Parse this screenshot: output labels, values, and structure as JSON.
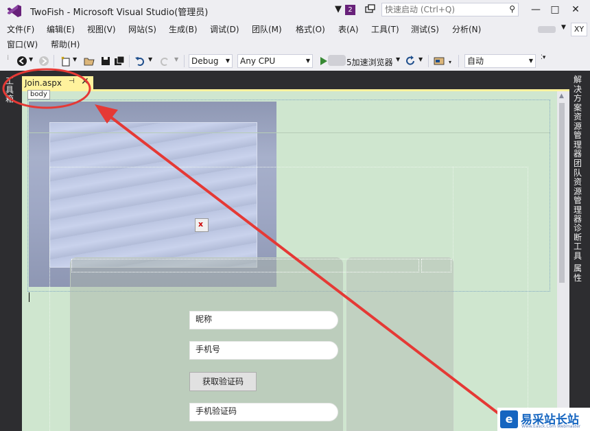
{
  "titlebar": {
    "title": "TwoFish - Microsoft Visual Studio(管理员)",
    "notifications": "2",
    "quick_launch_placeholder": "快速启动 (Ctrl+Q)",
    "min": "—",
    "max": "□",
    "close": "✕"
  },
  "menu": {
    "items": [
      "文件(F)",
      "编辑(E)",
      "视图(V)",
      "网站(S)",
      "生成(B)",
      "调试(D)",
      "团队(M)",
      "格式(O)",
      "表(A)",
      "工具(T)",
      "测试(S)",
      "分析(N)"
    ],
    "row2": [
      "窗口(W)",
      "帮助(H)"
    ],
    "account_initials": "XY"
  },
  "toolbar": {
    "config": "Debug",
    "platform": "Any CPU",
    "browser": "5加速浏览器",
    "position": "自动"
  },
  "side_panels": {
    "left": "工具箱",
    "right": [
      "解决方案资源管理器",
      "团队资源管理器",
      "诊断工具",
      "属性"
    ]
  },
  "document": {
    "tab_name": "Join.aspx",
    "tab_pin": "⊣",
    "tab_close": "✕",
    "body_tag": "body"
  },
  "form": {
    "nickname": "昵称",
    "phone": "手机号",
    "get_code": "获取验证码",
    "code": "手机验证码"
  },
  "watermark": {
    "logo": "e",
    "text": "易采站长站",
    "sub": "Www.Easck.Com Webmaster"
  },
  "colors": {
    "vs_purple": "#68217A",
    "tab_yellow": "#FFF29D",
    "design_green": "#CFE6CF",
    "annotation_red": "#E53935"
  }
}
